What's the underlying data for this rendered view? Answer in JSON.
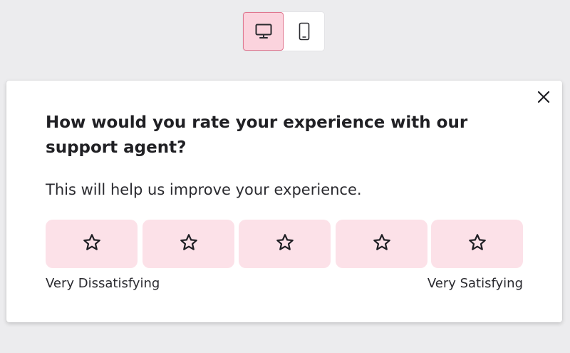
{
  "device_toggle": {
    "options": [
      {
        "icon": "desktop-icon",
        "active": true
      },
      {
        "icon": "mobile-icon",
        "active": false
      }
    ]
  },
  "survey": {
    "question": "How would you rate your experience with our support agent?",
    "subtext": "This will help us improve your experience.",
    "rating_icon": "star-outline-icon",
    "rating_count": 5,
    "selected_rating": 0,
    "low_label": "Very Dissatisfying",
    "high_label": "Very Satisfying",
    "close_icon": "close-icon"
  },
  "colors": {
    "page_background": "#ececee",
    "active_toggle_bg": "#fbd3dd",
    "active_toggle_border": "#e0768f",
    "rating_button_bg": "#fce1e8",
    "text": "#202024"
  }
}
